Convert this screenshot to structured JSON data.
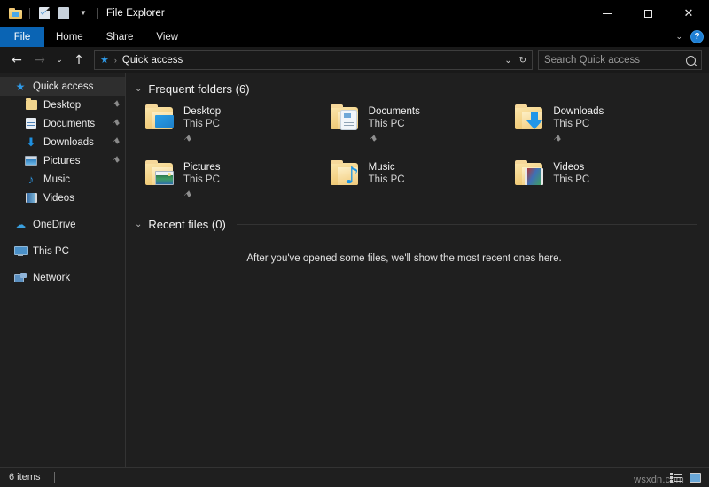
{
  "window": {
    "title": "File Explorer",
    "quick_access_toolbar": [
      {
        "name": "folder-icon",
        "label": "Properties folder"
      },
      {
        "name": "properties-icon",
        "label": "Properties"
      },
      {
        "name": "new-folder-icon",
        "label": "New folder"
      },
      {
        "name": "chevron-down-icon",
        "label": "Customize Quick Access Toolbar"
      }
    ],
    "controls": {
      "minimize": "─",
      "maximize": "□",
      "close": "✕"
    }
  },
  "ribbon": {
    "tabs": [
      {
        "label": "File",
        "active": true
      },
      {
        "label": "Home",
        "active": false
      },
      {
        "label": "Share",
        "active": false
      },
      {
        "label": "View",
        "active": false
      }
    ],
    "collapse_chevron": "⌄",
    "help_label": "?"
  },
  "address_bar": {
    "back": "←",
    "forward": "→",
    "recent_chevron": "⌄",
    "up": "↑",
    "breadcrumb_icon": "★",
    "breadcrumb_separator": "›",
    "breadcrumb_text": "Quick access",
    "dropdown": "⌄",
    "refresh": "↻",
    "search_placeholder": "Search Quick access",
    "search_value": ""
  },
  "sidebar": {
    "items": [
      {
        "label": "Quick access",
        "icon": "star-icon",
        "level": 0,
        "selected": true,
        "pinned": false
      },
      {
        "label": "Desktop",
        "icon": "desktop-icon",
        "level": 1,
        "selected": false,
        "pinned": true
      },
      {
        "label": "Documents",
        "icon": "documents-icon",
        "level": 1,
        "selected": false,
        "pinned": true
      },
      {
        "label": "Downloads",
        "icon": "downloads-icon",
        "level": 1,
        "selected": false,
        "pinned": true
      },
      {
        "label": "Pictures",
        "icon": "pictures-icon",
        "level": 1,
        "selected": false,
        "pinned": true
      },
      {
        "label": "Music",
        "icon": "music-icon",
        "level": 1,
        "selected": false,
        "pinned": false
      },
      {
        "label": "Videos",
        "icon": "videos-icon",
        "level": 1,
        "selected": false,
        "pinned": false
      },
      {
        "label": "OneDrive",
        "icon": "onedrive-icon",
        "level": 0,
        "selected": false,
        "pinned": false
      },
      {
        "label": "This PC",
        "icon": "this-pc-icon",
        "level": 0,
        "selected": false,
        "pinned": false
      },
      {
        "label": "Network",
        "icon": "network-icon",
        "level": 0,
        "selected": false,
        "pinned": false
      }
    ],
    "pin_glyph": "⚑"
  },
  "main": {
    "frequent": {
      "chevron": "⌄",
      "title": "Frequent folders (6)",
      "items": [
        {
          "name": "Desktop",
          "location": "This PC",
          "overlay": "monitor-overlay",
          "pinned": true
        },
        {
          "name": "Documents",
          "location": "This PC",
          "overlay": "document-overlay",
          "pinned": true
        },
        {
          "name": "Downloads",
          "location": "This PC",
          "overlay": "down-arrow-overlay",
          "pinned": true
        },
        {
          "name": "Pictures",
          "location": "This PC",
          "overlay": "photo-overlay",
          "pinned": true
        },
        {
          "name": "Music",
          "location": "This PC",
          "overlay": "music-note-overlay",
          "pinned": false
        },
        {
          "name": "Videos",
          "location": "This PC",
          "overlay": "film-strip-overlay",
          "pinned": false
        }
      ],
      "pin_glyph": "⚑"
    },
    "recent": {
      "chevron": "⌄",
      "title": "Recent files (0)",
      "empty_message": "After you've opened some files, we'll show the most recent ones here."
    }
  },
  "status_bar": {
    "item_count": "6 items",
    "view_details_label": "Details view",
    "view_large_label": "Large icons view",
    "watermark": "wsxdn.com"
  },
  "colors": {
    "accent": "#0a64b4",
    "window_bg": "#1f1f1f",
    "titlebar_bg": "#000000",
    "folder_yellow": "#f3d184",
    "link_blue": "#2e9ae8"
  }
}
